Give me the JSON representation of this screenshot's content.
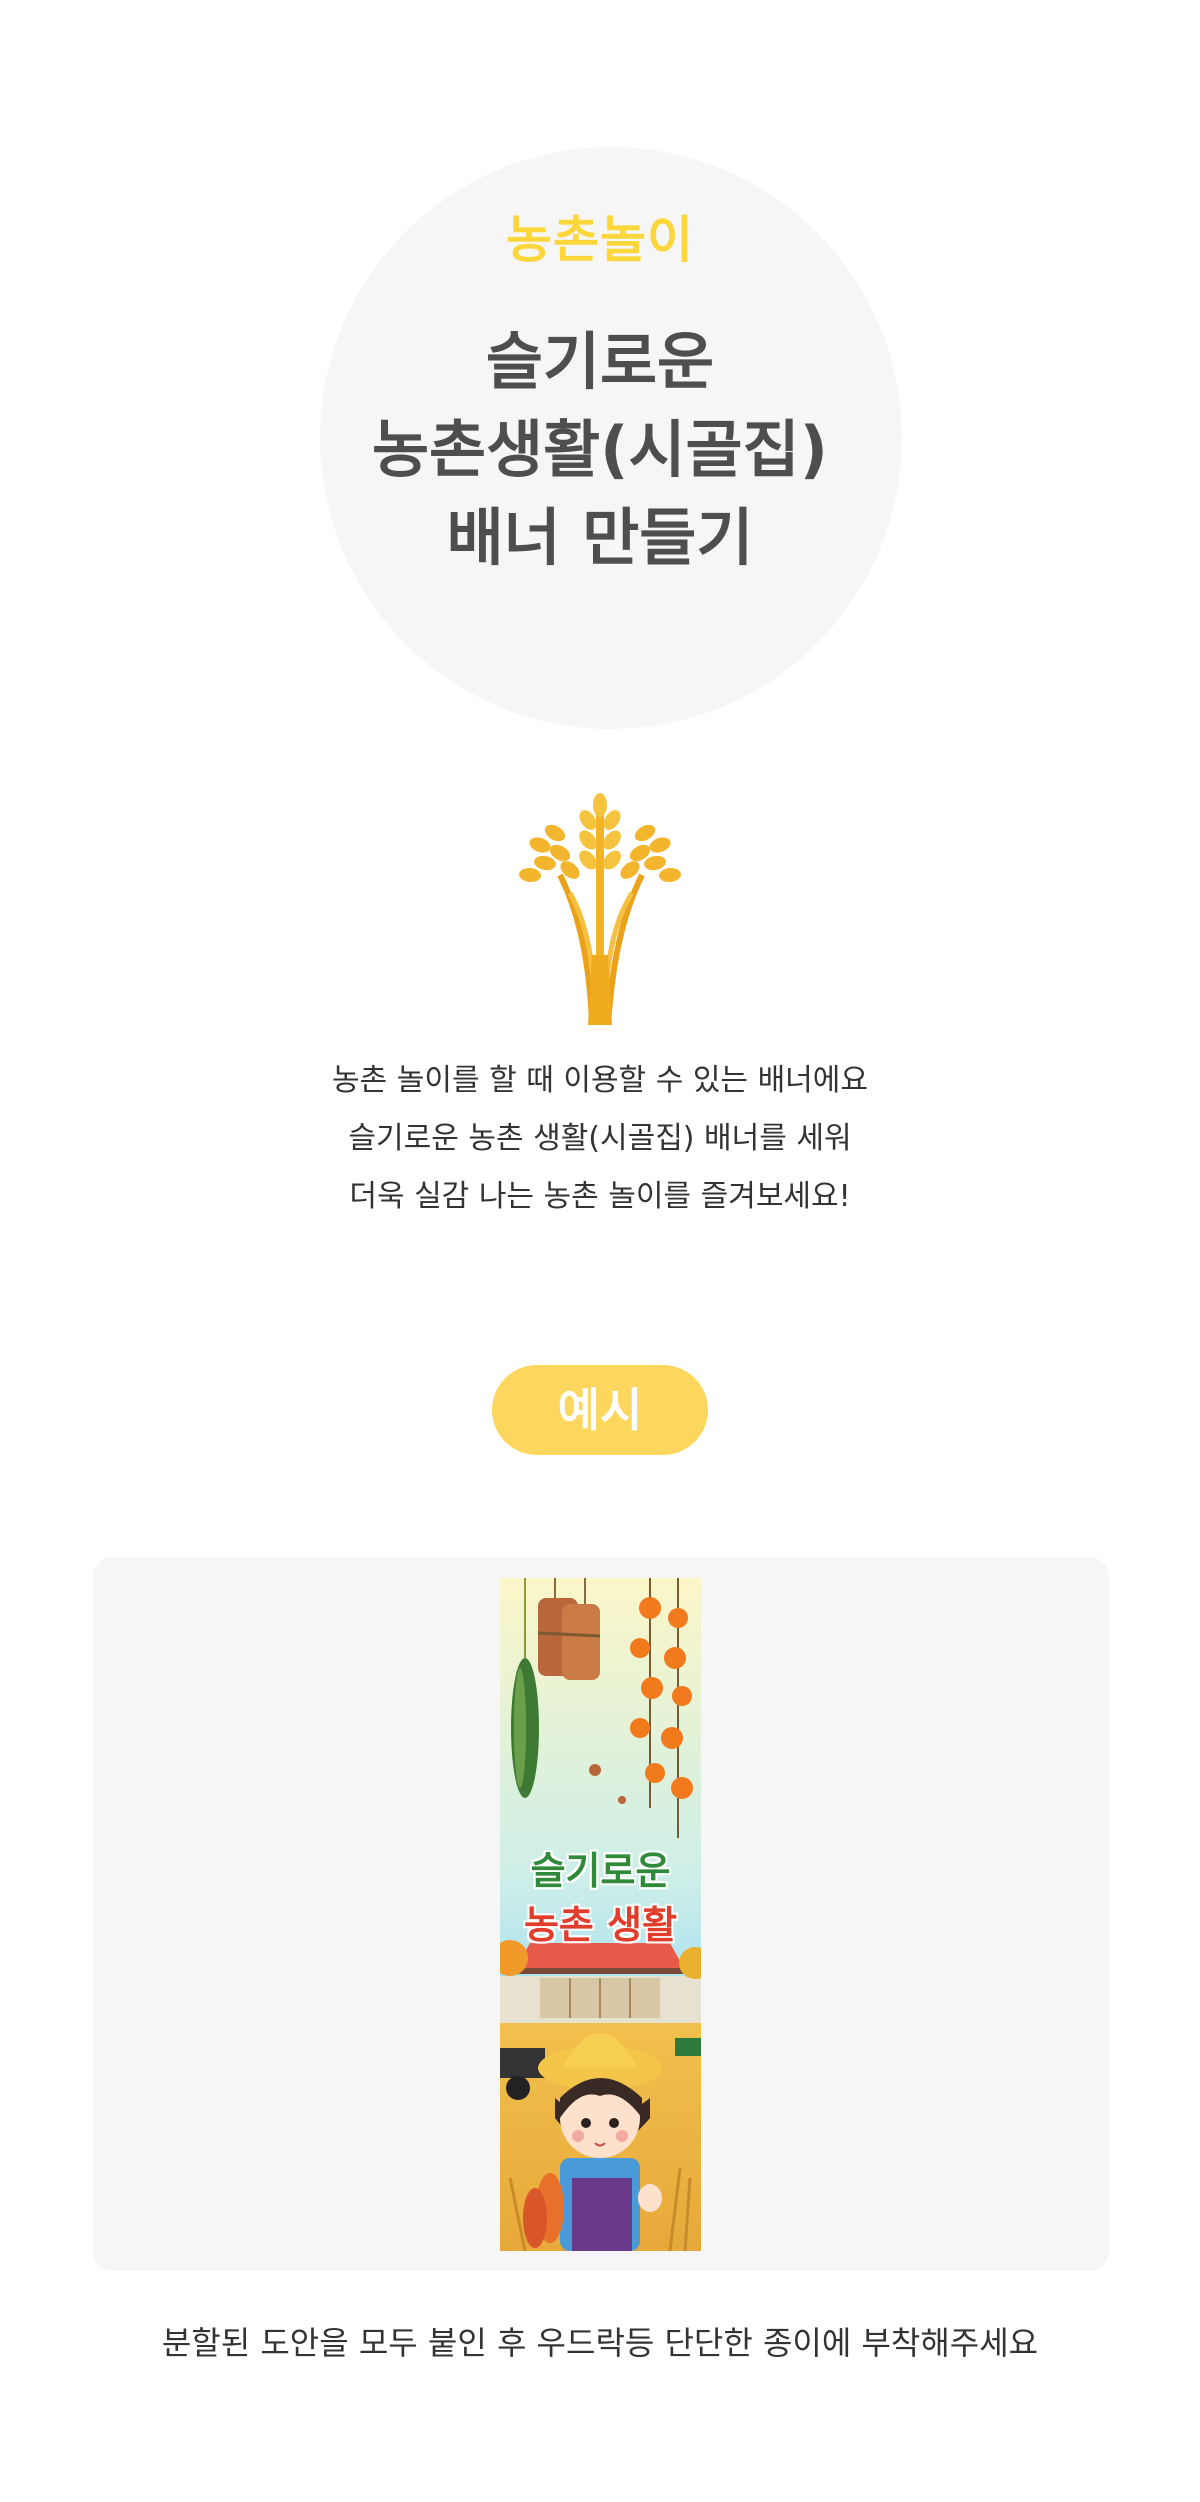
{
  "hero": {
    "category": "농촌놀이",
    "title_lines": [
      "슬기로운",
      "농촌생활(시골집)",
      "배너 만들기"
    ]
  },
  "description": {
    "lines": [
      "농촌 놀이를 할 때 이용할 수 있는 배너에요",
      "슬기로운 농촌 생활(시골집) 배너를 세워",
      "더욱 실감 나는 농촌 놀이를 즐겨보세요!"
    ]
  },
  "example": {
    "label": "예시",
    "banner_title_line1": "슬기로운",
    "banner_title_line2": "농촌 생활"
  },
  "caption": "분할된 도안을 모두 붙인 후 우드락등 단단한 종이에 부착해주세요",
  "colors": {
    "accent_yellow": "#fcd63a",
    "pill_yellow": "#fdd65e",
    "panel_gray": "#f6f6f6",
    "title_gray": "#4e4e4e"
  },
  "icons": [
    "wheat-icon"
  ]
}
